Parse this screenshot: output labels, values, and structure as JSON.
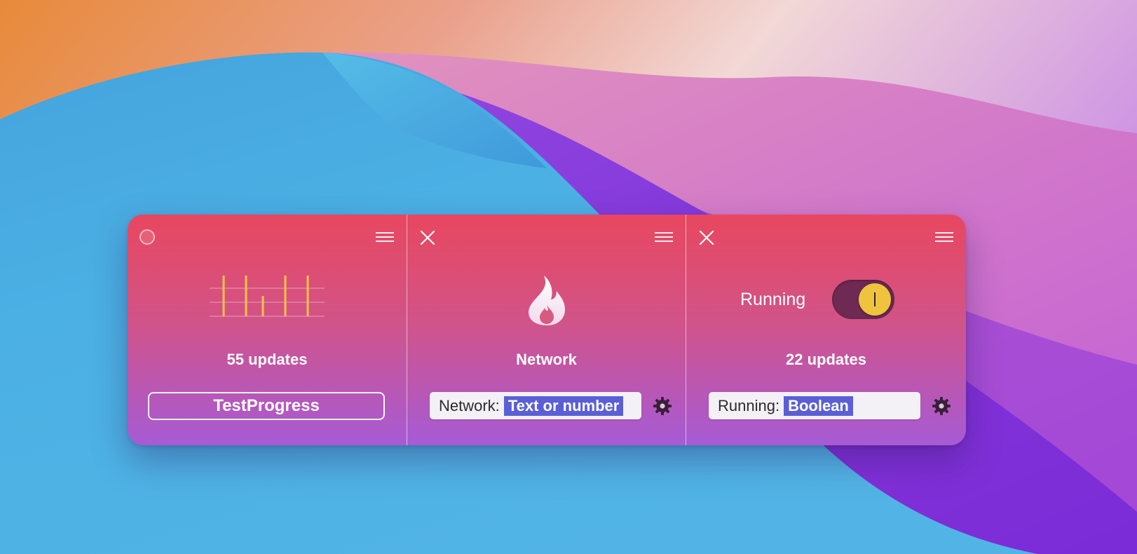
{
  "panels": [
    {
      "caption": "55 updates",
      "name": "TestProgress",
      "bar_heights": [
        1.0,
        1.0,
        0.5,
        1.0,
        1.0
      ],
      "bar_color": "#f4c542"
    },
    {
      "caption": "Network",
      "field_label": "Network:",
      "field_value": "Text or number"
    },
    {
      "toggle_label": "Running",
      "toggle_on": true,
      "caption": "22 updates",
      "field_label": "Running:",
      "field_value": "Boolean"
    }
  ],
  "colors": {
    "strip_top": "#e8475f",
    "strip_bottom": "#a65bd6",
    "highlight": "#5a5fd6",
    "toggle_track": "#6e2a52",
    "toggle_knob": "#f0c33f"
  },
  "icons": [
    "circle-button-icon",
    "close-icon",
    "hamburger-menu-icon",
    "flame-icon",
    "gear-icon",
    "sparkline-bars-icon"
  ]
}
